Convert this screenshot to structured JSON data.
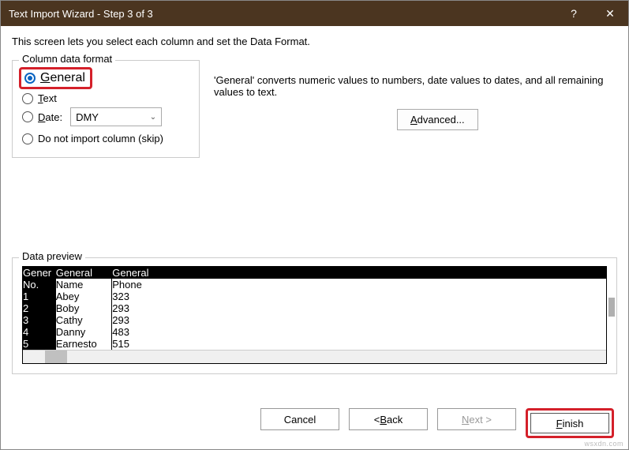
{
  "titlebar": {
    "title": "Text Import Wizard - Step 3 of 3",
    "help": "?",
    "close": "✕"
  },
  "intro": "This screen lets you select each column and set the Data Format.",
  "format": {
    "legend": "Column data format",
    "general": "General",
    "text": "Text",
    "date_label": "Date:",
    "date_value": "DMY",
    "skip": "Do not import column (skip)"
  },
  "right": {
    "desc": "'General' converts numeric values to numbers, date values to dates, and all remaining values to text.",
    "advanced": "Advanced..."
  },
  "preview": {
    "legend": "Data preview",
    "headers": [
      "Gener",
      "General",
      "General"
    ],
    "rows": [
      [
        "No.",
        "Name",
        "Phone"
      ],
      [
        "1",
        "Abey",
        "323"
      ],
      [
        "2",
        "Boby",
        "293"
      ],
      [
        "3",
        "Cathy",
        "293"
      ],
      [
        "4",
        "Danny",
        "483"
      ],
      [
        "5",
        "Earnesto",
        "515"
      ]
    ]
  },
  "buttons": {
    "cancel": "Cancel",
    "back": "< Back",
    "next": "Next >",
    "finish": "Finish"
  },
  "watermark": "wsxdn.com"
}
